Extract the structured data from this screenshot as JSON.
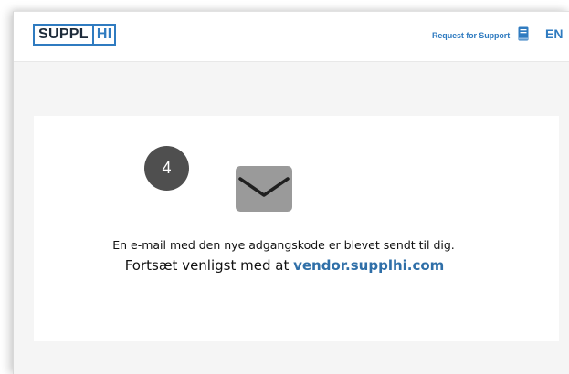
{
  "header": {
    "logo_part1": "SUPPL",
    "logo_part2": "HI",
    "support_label": "Request for Support",
    "language": "EN",
    "icons": {
      "help": "book-icon"
    }
  },
  "main": {
    "step_number": "4",
    "icon": "envelope-icon",
    "message_line1": "En e-mail med den nye adgangskode er blevet sendt til dig.",
    "message_line2_prefix": "Fortsæt venligst med at ",
    "message_line2_link": "vendor.supplhi.com"
  },
  "colors": {
    "brand_blue": "#2f7bc0",
    "link_blue": "#2f6fa8",
    "badge_gray": "#4f4f4f",
    "icon_gray": "#9a9a9a",
    "page_bg": "#f5f5f5"
  }
}
